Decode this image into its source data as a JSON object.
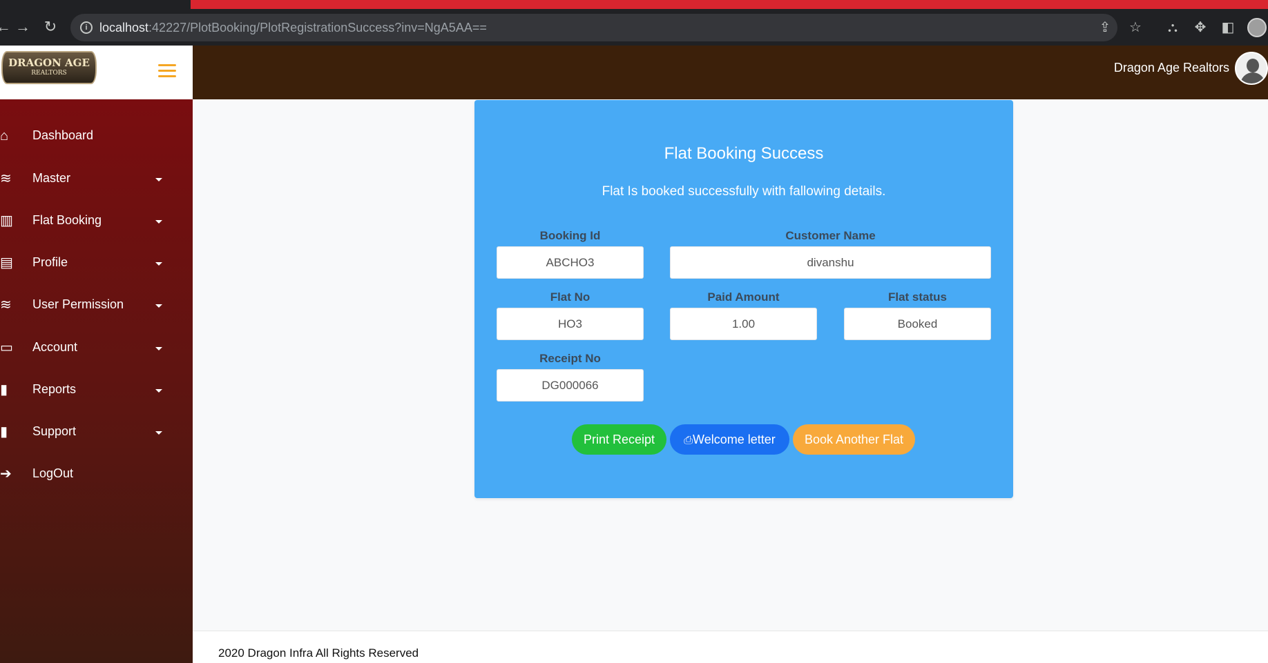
{
  "browser": {
    "url_host": "localhost",
    "url_path": ":42227/PlotBooking/PlotRegistrationSuccess?inv=NgA5AA==",
    "icons": [
      "back-arrow-icon",
      "forward-arrow-icon",
      "reload-icon",
      "info-icon",
      "share-icon",
      "star-icon",
      "extension-icon",
      "puzzle-icon",
      "sidepanel-icon",
      "profile-icon"
    ]
  },
  "header": {
    "logo_line1": "DRAGON AGE",
    "logo_line2": "REALTORS",
    "user_name": "Dragon Age Realtors"
  },
  "sidebar": {
    "items": [
      {
        "label": "Dashboard",
        "icon": "home-icon",
        "glyph": "⌂",
        "has_caret": false
      },
      {
        "label": "Master",
        "icon": "layers-icon",
        "glyph": "≋",
        "has_caret": true
      },
      {
        "label": "Flat Booking",
        "icon": "map-icon",
        "glyph": "▥",
        "has_caret": true
      },
      {
        "label": "Profile",
        "icon": "id-card-icon",
        "glyph": "▤",
        "has_caret": true
      },
      {
        "label": "User Permission",
        "icon": "layers-icon",
        "glyph": "≋",
        "has_caret": true
      },
      {
        "label": "Account",
        "icon": "credit-card-icon",
        "glyph": "▭",
        "has_caret": true
      },
      {
        "label": "Reports",
        "icon": "book-icon",
        "glyph": "▮",
        "has_caret": true
      },
      {
        "label": "Support",
        "icon": "book-icon",
        "glyph": "▮",
        "has_caret": true
      },
      {
        "label": "LogOut",
        "icon": "sign-out-icon",
        "glyph": "➔",
        "has_caret": false
      }
    ]
  },
  "card": {
    "title": "Flat Booking Success",
    "subtitle": "Flat Is booked successfully with fallowing details.",
    "fields": {
      "booking_id": {
        "label": "Booking Id",
        "value": "ABCHO3"
      },
      "customer_name": {
        "label": "Customer Name",
        "value": "divanshu"
      },
      "flat_no": {
        "label": "Flat No",
        "value": "HO3"
      },
      "paid_amount": {
        "label": "Paid Amount",
        "value": "1.00"
      },
      "flat_status": {
        "label": "Flat status",
        "value": "Booked"
      },
      "receipt_no": {
        "label": "Receipt No",
        "value": "DG000066"
      }
    },
    "buttons": {
      "print_receipt": "Print Receipt",
      "welcome_letter": "Welcome letter",
      "book_another": "Book Another Flat"
    }
  },
  "footer": {
    "text": "2020 Dragon Infra All Rights Reserved"
  },
  "colors": {
    "topbar": "#3c200a",
    "sidebar": "#7a0d10",
    "card": "#48aaf5",
    "green_button": "#22c03c",
    "blue_button": "#1a6ff1",
    "orange_button": "#f8a93b",
    "hamburger": "#f5a623"
  }
}
